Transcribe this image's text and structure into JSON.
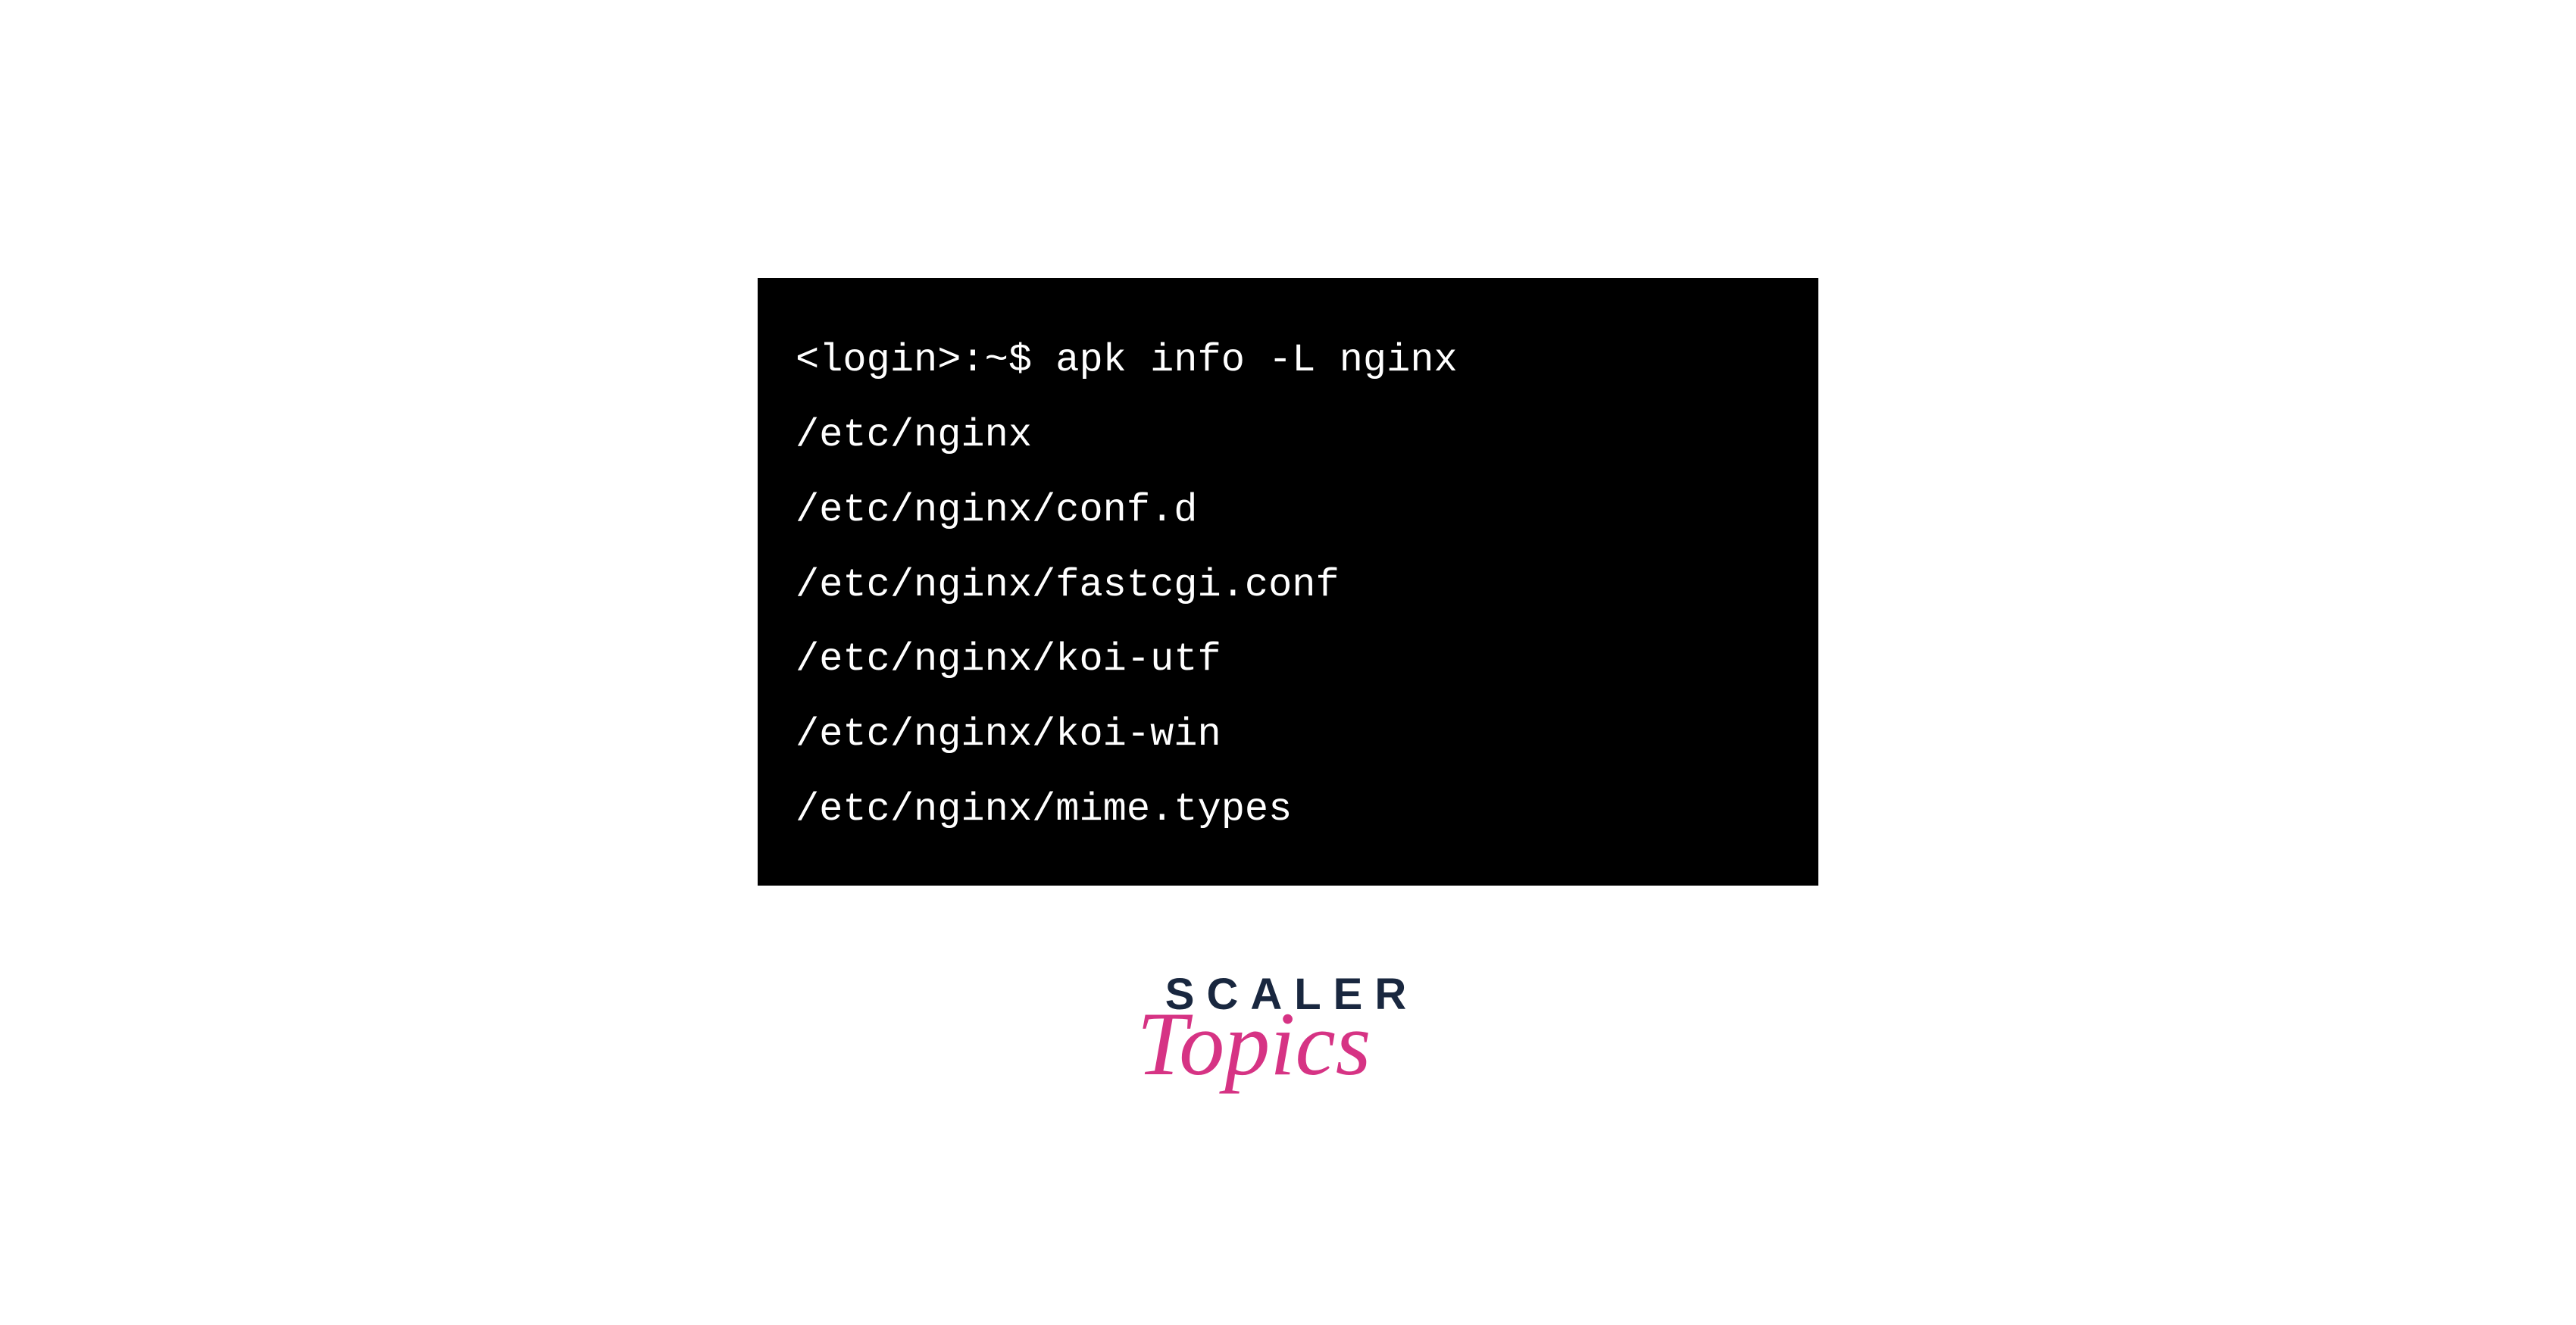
{
  "terminal": {
    "lines": [
      "<login>:~$ apk info -L nginx",
      "/etc/nginx",
      "/etc/nginx/conf.d",
      "/etc/nginx/fastcgi.conf",
      "/etc/nginx/koi-utf",
      "/etc/nginx/koi-win",
      "/etc/nginx/mime.types"
    ]
  },
  "logo": {
    "line1": "SCALER",
    "line2": "Topics"
  }
}
